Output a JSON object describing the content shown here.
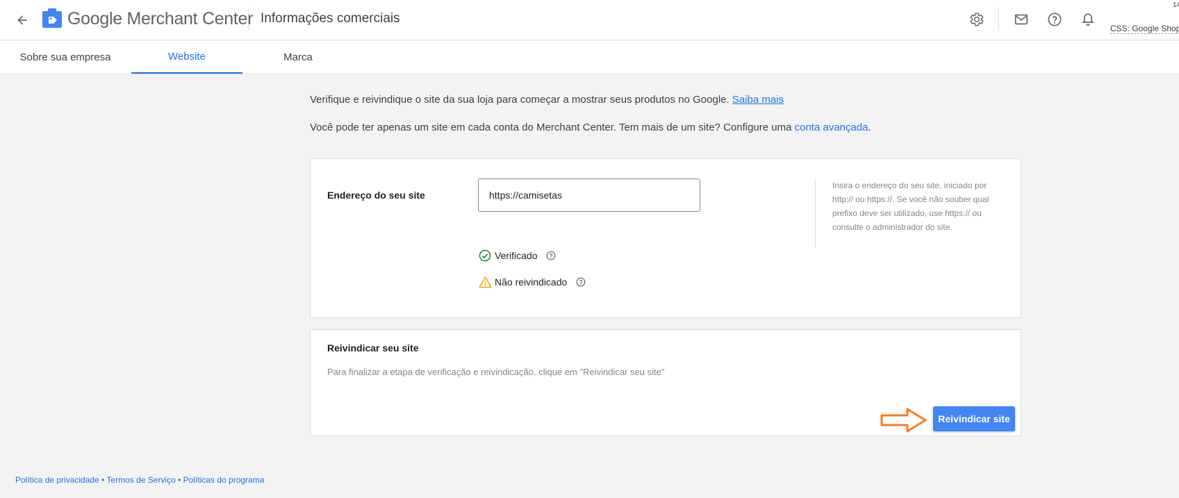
{
  "header": {
    "brand_google": "Google",
    "brand_product": "Merchant Center",
    "page_title": "Informações comerciais",
    "account_id_partial": "14",
    "account_name": "CSS: Google Shop"
  },
  "tabs": [
    {
      "label": "Sobre sua empresa",
      "active": false
    },
    {
      "label": "Website",
      "active": true
    },
    {
      "label": "Marca",
      "active": false
    }
  ],
  "intro": {
    "line1_text": "Verifique e reivindique o site da sua loja para começar a mostrar seus produtos no Google.",
    "line1_link": "Saiba mais",
    "line2_text": "Você pode ter apenas um site em cada conta do Merchant Center. Tem mais de um site? Configure uma",
    "line2_link": "conta avançada",
    "line2_end": "."
  },
  "website_card": {
    "field_label": "Endereço do seu site",
    "url_value": "https://camisetas",
    "hint": "Insira o endereço do seu site, iniciado por http:// ou https://. Se você não souber qual prefixo deve ser utilizado, use https:// ou consulte o administrador do site.",
    "status_verified": "Verificado",
    "status_not_claimed": "Não reivindicado"
  },
  "claim_card": {
    "title": "Reivindicar seu site",
    "description": "Para finalizar a etapa de verificação e reivindicação, clique em \"Reivindicar seu site\"",
    "button_label": "Reivindicar site"
  },
  "footer": {
    "privacy": "Política de privacidade",
    "terms": "Termos de Serviço",
    "policies": "Políticas do programa",
    "separator": " • "
  },
  "colors": {
    "accent": "#1a73e8",
    "button": "#4285f4",
    "verified": "#188038",
    "warning": "#f9ab00",
    "annotation_arrow": "#f57c20"
  }
}
